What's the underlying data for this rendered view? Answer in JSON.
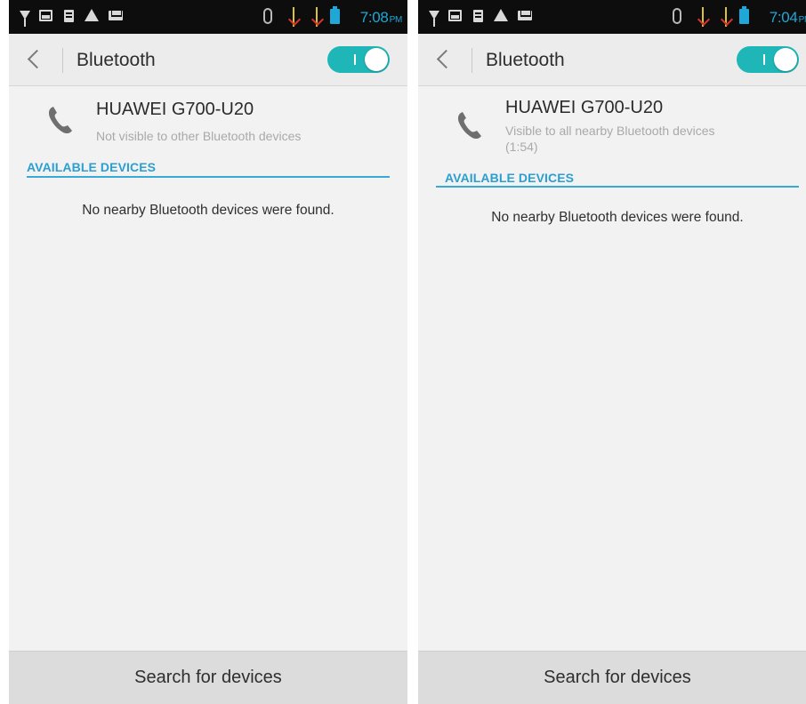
{
  "screens": [
    {
      "status_bar": {
        "time": "7:08",
        "ampm": "PM"
      },
      "header": {
        "title": "Bluetooth",
        "toggle_state": "on"
      },
      "device": {
        "name": "HUAWEI G700-U20",
        "status_line1": "Not visible to other Bluetooth devices",
        "status_line2": ""
      },
      "section": {
        "label": "AVAILABLE DEVICES"
      },
      "empty_message": "No nearby Bluetooth devices were found.",
      "bottom": {
        "label": "Search for devices"
      }
    },
    {
      "status_bar": {
        "time": "7:04",
        "ampm": "PM"
      },
      "header": {
        "title": "Bluetooth",
        "toggle_state": "on"
      },
      "device": {
        "name": "HUAWEI G700-U20",
        "status_line1": "Visible to all nearby Bluetooth devices",
        "status_line2": "(1:54)"
      },
      "section": {
        "label": "AVAILABLE DEVICES"
      },
      "empty_message": "No nearby Bluetooth devices were found.",
      "bottom": {
        "label": "Search for devices"
      }
    }
  ],
  "colors": {
    "accent": "#1ea7d7",
    "toggle_on": "#1fb6b8",
    "section_text": "#2a9fd0",
    "background": "#f2f2f2"
  },
  "icons": [
    "wifi-icon",
    "gallery-icon",
    "sd-card-icon",
    "warning-icon",
    "mail-icon",
    "bluetooth-icon",
    "signal-icon",
    "battery-icon",
    "back-arrow-icon",
    "phone-icon"
  ]
}
